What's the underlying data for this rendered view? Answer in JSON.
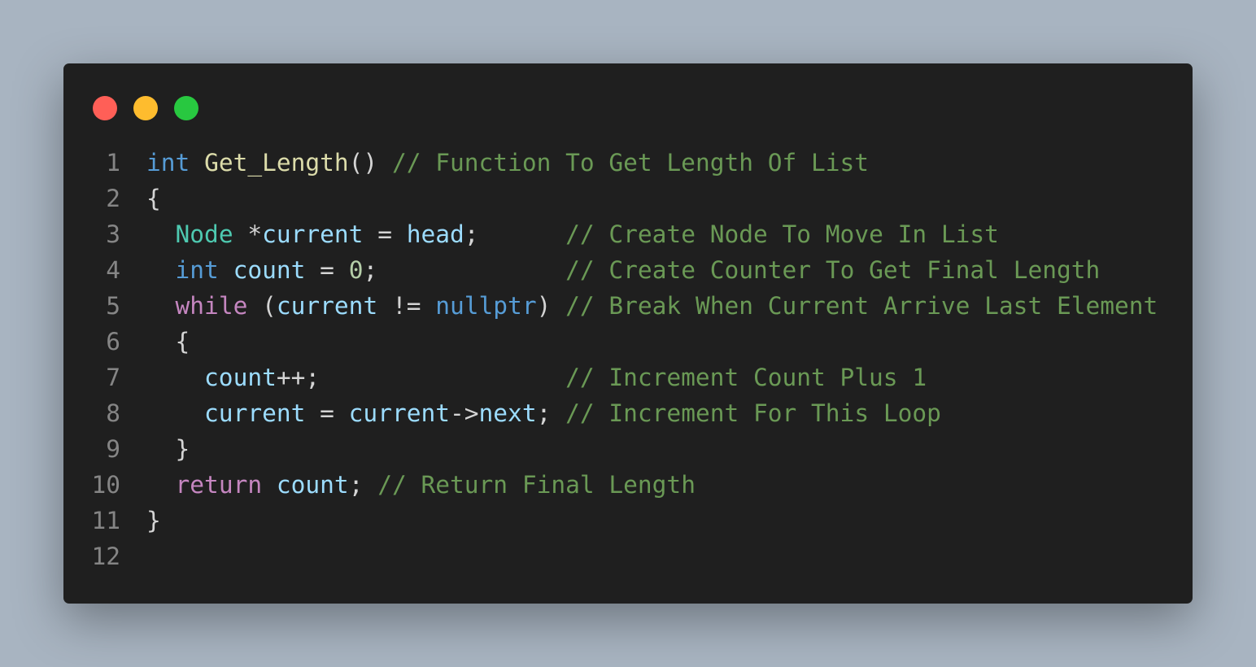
{
  "window": {
    "colors": {
      "background": "#1f1f1f",
      "page_background": "#a8b4c1",
      "dot_red": "#ff5f57",
      "dot_yellow": "#febc2e",
      "dot_green": "#28c840"
    }
  },
  "code": {
    "language": "cpp",
    "lines": [
      {
        "number": "1",
        "tokens": [
          {
            "text": "int",
            "type": "kw-type"
          },
          {
            "text": " ",
            "type": "punc"
          },
          {
            "text": "Get_Length",
            "type": "fn"
          },
          {
            "text": "() ",
            "type": "punc"
          },
          {
            "text": "// Function To Get Length Of List",
            "type": "cmt"
          }
        ]
      },
      {
        "number": "2",
        "tokens": [
          {
            "text": "{",
            "type": "punc"
          }
        ]
      },
      {
        "number": "3",
        "tokens": [
          {
            "text": "  ",
            "type": "punc"
          },
          {
            "text": "Node",
            "type": "type"
          },
          {
            "text": " *",
            "type": "punc"
          },
          {
            "text": "current",
            "type": "var"
          },
          {
            "text": " = ",
            "type": "punc"
          },
          {
            "text": "head",
            "type": "var"
          },
          {
            "text": ";      ",
            "type": "punc"
          },
          {
            "text": "// Create Node To Move In List",
            "type": "cmt"
          }
        ]
      },
      {
        "number": "4",
        "tokens": [
          {
            "text": "  ",
            "type": "punc"
          },
          {
            "text": "int",
            "type": "kw-type"
          },
          {
            "text": " ",
            "type": "punc"
          },
          {
            "text": "count",
            "type": "var"
          },
          {
            "text": " = ",
            "type": "punc"
          },
          {
            "text": "0",
            "type": "num"
          },
          {
            "text": ";             ",
            "type": "punc"
          },
          {
            "text": "// Create Counter To Get Final Length",
            "type": "cmt"
          }
        ]
      },
      {
        "number": "5",
        "tokens": [
          {
            "text": "  ",
            "type": "punc"
          },
          {
            "text": "while",
            "type": "kw-ctrl"
          },
          {
            "text": " (",
            "type": "punc"
          },
          {
            "text": "current",
            "type": "var"
          },
          {
            "text": " != ",
            "type": "punc"
          },
          {
            "text": "nullptr",
            "type": "kw-type"
          },
          {
            "text": ") ",
            "type": "punc"
          },
          {
            "text": "// Break When Current Arrive Last Element",
            "type": "cmt"
          }
        ]
      },
      {
        "number": "6",
        "tokens": [
          {
            "text": "  {",
            "type": "punc"
          }
        ]
      },
      {
        "number": "7",
        "tokens": [
          {
            "text": "    ",
            "type": "punc"
          },
          {
            "text": "count",
            "type": "var"
          },
          {
            "text": "++;                 ",
            "type": "punc"
          },
          {
            "text": "// Increment Count Plus 1",
            "type": "cmt"
          }
        ]
      },
      {
        "number": "8",
        "tokens": [
          {
            "text": "    ",
            "type": "punc"
          },
          {
            "text": "current",
            "type": "var"
          },
          {
            "text": " = ",
            "type": "punc"
          },
          {
            "text": "current",
            "type": "var"
          },
          {
            "text": "->",
            "type": "punc"
          },
          {
            "text": "next",
            "type": "var"
          },
          {
            "text": "; ",
            "type": "punc"
          },
          {
            "text": "// Increment For This Loop",
            "type": "cmt"
          }
        ]
      },
      {
        "number": "9",
        "tokens": [
          {
            "text": "  }",
            "type": "punc"
          }
        ]
      },
      {
        "number": "10",
        "tokens": [
          {
            "text": "  ",
            "type": "punc"
          },
          {
            "text": "return",
            "type": "kw-ctrl"
          },
          {
            "text": " ",
            "type": "punc"
          },
          {
            "text": "count",
            "type": "var"
          },
          {
            "text": "; ",
            "type": "punc"
          },
          {
            "text": "// Return Final Length",
            "type": "cmt"
          }
        ]
      },
      {
        "number": "11",
        "tokens": [
          {
            "text": "}",
            "type": "punc"
          }
        ]
      },
      {
        "number": "12",
        "tokens": []
      }
    ]
  }
}
